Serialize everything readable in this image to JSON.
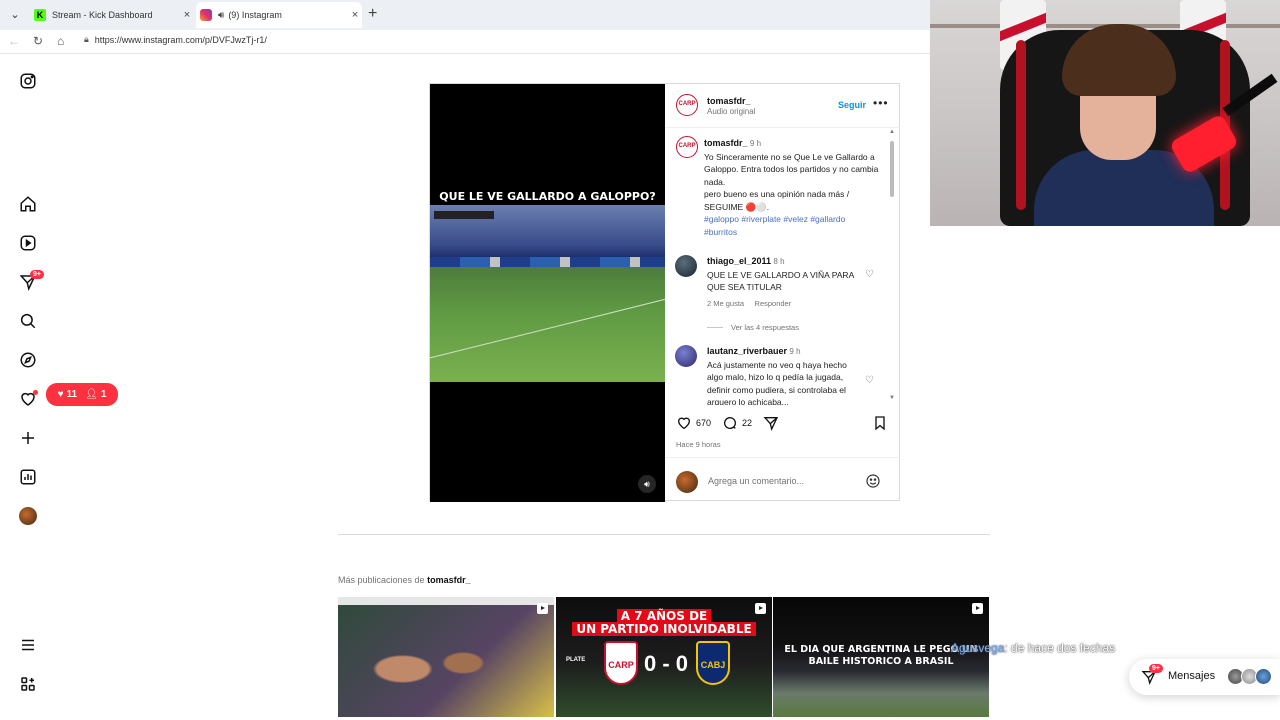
{
  "browser": {
    "tabs": [
      {
        "title": "Stream - Kick Dashboard",
        "favicon": "kick-icon"
      },
      {
        "title": "(9) Instagram",
        "favicon": "instagram-icon"
      }
    ],
    "new_tab_glyph": "+",
    "close_glyph": "×",
    "url": "https://www.instagram.com/p/DVFJwzTj-r1/"
  },
  "sidebar": {
    "notifications_badge": "9+",
    "notification_pill": {
      "likes": "11",
      "follows": "1"
    },
    "items": [
      "instagram-logo",
      "home",
      "reels",
      "messages",
      "search",
      "explore",
      "notifications",
      "create",
      "dashboard",
      "profile",
      "more",
      "also-from-meta"
    ]
  },
  "post": {
    "author": "tomasfdr_",
    "audio": "Audio original",
    "follow_label": "Seguir",
    "more_glyph": "•••",
    "avatar_text": "CARP",
    "video_caption": "QUE LE VE GALLARDO A GALOPPO?",
    "caption": {
      "author": "tomasfdr_",
      "time": "9 h",
      "text": "Yo Sinceramente no se Que Le ve Gallardo a Galoppo. Entra todos los partidos y no cambia nada.\npero bueno es una opinión nada más / SEGUIME 🔴⚪.",
      "hashtags": "#galoppo #riverplate #velez #gallardo #burritos"
    },
    "comments": [
      {
        "author": "thiago_el_2011",
        "time": "8 h",
        "text": "QUE LE VE GALLARDO A VIÑA PARA QUE SEA TITULAR",
        "likes": "2 Me gusta",
        "reply": "Responder",
        "view_replies": "Ver las 4 respuestas"
      },
      {
        "author": "lautanz_riverbauer",
        "time": "9 h",
        "text": "Acá justamente no veo q haya hecho algo malo, hizo lo q pedía la jugada, definir como pudiera, si controlaba el arquero lo achicaba..."
      }
    ],
    "like_count": "670",
    "comment_count": "22",
    "posted": "Hace 9 horas",
    "comment_placeholder": "Agrega un comentario..."
  },
  "more_posts": {
    "prefix": "Más publicaciones de",
    "author": "tomasfdr_",
    "items": [
      {
        "title": ""
      },
      {
        "line1": "A 7 AÑOS DE",
        "line2": "UN PARTIDO INOLVIDABLE",
        "score": "0 - 0",
        "team1": "CARP",
        "team2": "CABJ",
        "league": "PLATE"
      },
      {
        "line1": "EL DIA QUE ARGENTINA LE PEGO UN",
        "line2": "BAILE HISTORICO A BRASIL"
      }
    ]
  },
  "stream_overlay": {
    "name": "Agusvega",
    "text": ": de hace dos fechas"
  },
  "messages_dock": {
    "label": "Mensajes",
    "badge": "9+"
  },
  "colors": {
    "instagram_blue": "#0095f6",
    "notification_red": "#ff3040",
    "river_red": "#c8102e"
  }
}
